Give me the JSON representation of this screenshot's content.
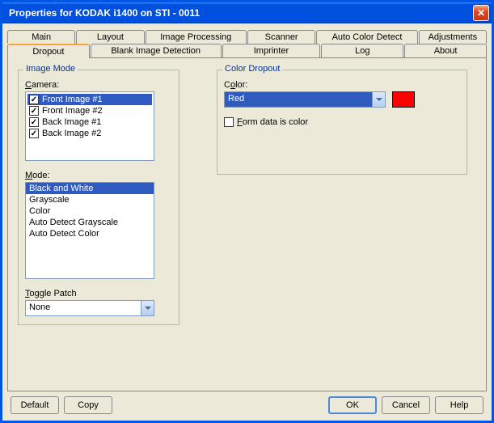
{
  "window": {
    "title": "Properties for KODAK i1400 on STI - 0011"
  },
  "tabs_row1": {
    "main": "Main",
    "layout": "Layout",
    "image_processing": "Image Processing",
    "scanner": "Scanner",
    "auto_color": "Auto Color Detect",
    "adjustments": "Adjustments"
  },
  "tabs_row2": {
    "dropout": "Dropout",
    "blank_image": "Blank Image Detection",
    "imprinter": "Imprinter",
    "log": "Log",
    "about": "About"
  },
  "image_mode": {
    "title": "Image Mode",
    "camera_label": "Camera:",
    "camera_items": [
      {
        "label": "Front Image #1",
        "checked": true,
        "selected": true
      },
      {
        "label": "Front Image #2",
        "checked": true,
        "selected": false
      },
      {
        "label": "Back Image #1",
        "checked": true,
        "selected": false
      },
      {
        "label": "Back Image #2",
        "checked": true,
        "selected": false
      }
    ],
    "mode_label": "Mode:",
    "mode_items": [
      {
        "label": "Black and White",
        "selected": true
      },
      {
        "label": "Grayscale",
        "selected": false
      },
      {
        "label": "Color",
        "selected": false
      },
      {
        "label": "Auto Detect Grayscale",
        "selected": false
      },
      {
        "label": "Auto Detect Color",
        "selected": false
      }
    ],
    "toggle_label": "Toggle Patch",
    "toggle_value": "None"
  },
  "color_dropout": {
    "title": "Color Dropout",
    "color_label": "Color:",
    "color_value": "Red",
    "swatch_hex": "#ff0000",
    "form_label": "Form data is color",
    "form_checked": false
  },
  "buttons": {
    "default": "Default",
    "copy": "Copy",
    "ok": "OK",
    "cancel": "Cancel",
    "help": "Help"
  }
}
